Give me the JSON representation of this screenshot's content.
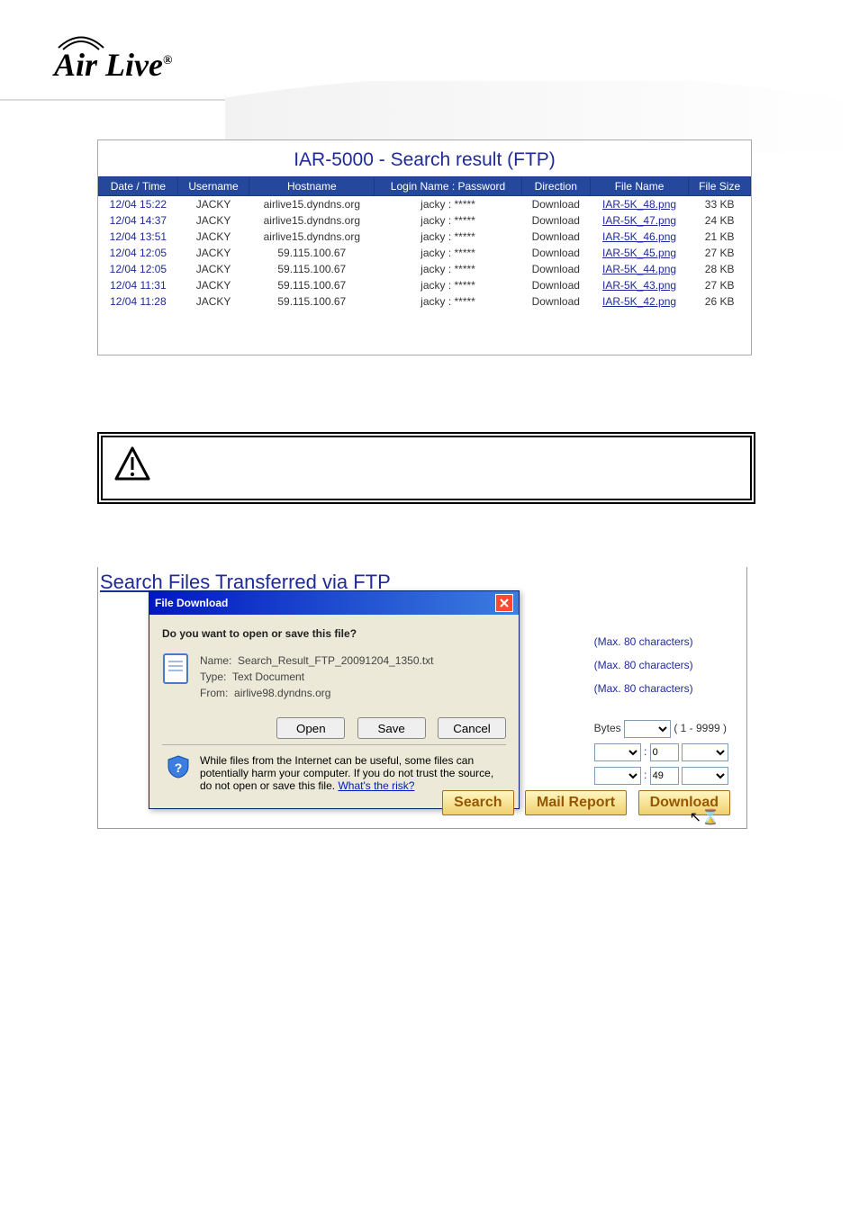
{
  "logo": {
    "text": "Air Live",
    "reg": "®"
  },
  "table": {
    "title": "IAR-5000 - Search result (FTP)",
    "headers": [
      "Date / Time",
      "Username",
      "Hostname",
      "Login Name : Password",
      "Direction",
      "File Name",
      "File Size"
    ],
    "rows": [
      {
        "date": "12/04 15:22",
        "user": "JACKY",
        "host": "airlive15.dyndns.org",
        "login": "jacky : *****",
        "dir": "Download",
        "file": "IAR-5K_48.png",
        "size": "33 KB"
      },
      {
        "date": "12/04 14:37",
        "user": "JACKY",
        "host": "airlive15.dyndns.org",
        "login": "jacky : *****",
        "dir": "Download",
        "file": "IAR-5K_47.png",
        "size": "24 KB"
      },
      {
        "date": "12/04 13:51",
        "user": "JACKY",
        "host": "airlive15.dyndns.org",
        "login": "jacky : *****",
        "dir": "Download",
        "file": "IAR-5K_46.png",
        "size": "21 KB"
      },
      {
        "date": "12/04 12:05",
        "user": "JACKY",
        "host": "59.115.100.67",
        "login": "jacky : *****",
        "dir": "Download",
        "file": "IAR-5K_45.png",
        "size": "27 KB"
      },
      {
        "date": "12/04 12:05",
        "user": "JACKY",
        "host": "59.115.100.67",
        "login": "jacky : *****",
        "dir": "Download",
        "file": "IAR-5K_44.png",
        "size": "28 KB"
      },
      {
        "date": "12/04 11:31",
        "user": "JACKY",
        "host": "59.115.100.67",
        "login": "jacky : *****",
        "dir": "Download",
        "file": "IAR-5K_43.png",
        "size": "27 KB"
      },
      {
        "date": "12/04 11:28",
        "user": "JACKY",
        "host": "59.115.100.67",
        "login": "jacky : *****",
        "dir": "Download",
        "file": "IAR-5K_42.png",
        "size": "26 KB"
      }
    ]
  },
  "search_title": "Search Files Transferred via FTP",
  "dialog": {
    "title": "File Download",
    "question": "Do you want to open or save this file?",
    "name_label": "Name:",
    "name_value": "Search_Result_FTP_20091204_1350.txt",
    "type_label": "Type:",
    "type_value": "Text Document",
    "from_label": "From:",
    "from_value": "airlive98.dyndns.org",
    "open": "Open",
    "save": "Save",
    "cancel": "Cancel",
    "warn": "While files from the Internet can be useful, some files can potentially harm your computer. If you do not trust the source, do not open or save this file.",
    "risk": "What's the risk?"
  },
  "form": {
    "max80": "(Max. 80 characters)",
    "bytes_label": "Bytes",
    "one9999": "( 1 - 9999 )",
    "zero": "0",
    "fortynine": "49"
  },
  "buttons": {
    "search": "Search",
    "mail": "Mail Report",
    "download": "Download"
  }
}
